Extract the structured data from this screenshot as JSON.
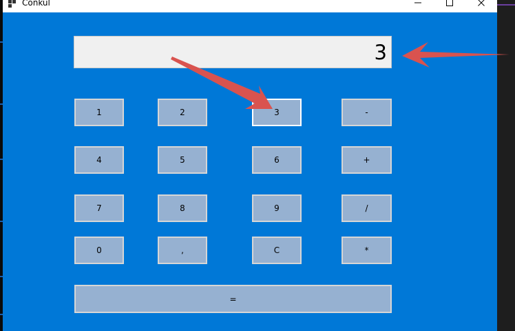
{
  "window": {
    "title": "Conkul",
    "controls": [
      "minimize-icon",
      "maximize-icon",
      "close-icon"
    ]
  },
  "display": {
    "value": "3"
  },
  "keypad": {
    "keys": [
      "1",
      "2",
      "3",
      "-",
      "4",
      "5",
      "6",
      "+",
      "7",
      "8",
      "9",
      "/",
      "0",
      ",",
      "C",
      "*"
    ],
    "equals": "="
  },
  "annotations": {
    "arrow_color": "#d9534f",
    "arrows": [
      "arrow-to-display",
      "arrow-to-key-3"
    ]
  },
  "colors": {
    "form_background": "#0078d7",
    "button_background": "#96b1d1",
    "display_background": "#f0f0f0"
  }
}
